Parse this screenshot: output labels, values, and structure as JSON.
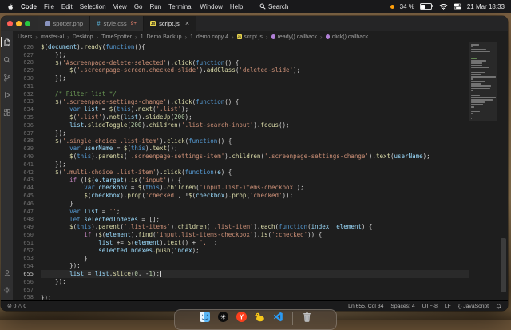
{
  "theme": {
    "p": "#d4d4d4",
    "f": "#dcdcaa",
    "k": "#569cd6",
    "c": "#c586c0",
    "s": "#ce9178",
    "n": "#b5cea8",
    "m": "#6a9955",
    "v": "#9cdcfe"
  },
  "menubar": {
    "menus": [
      "Code",
      "File",
      "Edit",
      "Selection",
      "View",
      "Go",
      "Run",
      "Terminal",
      "Window",
      "Help"
    ],
    "spotlight_label": "Search",
    "battery_percent": "34 %",
    "clock": "21 Mar 18:33"
  },
  "window": {
    "tabs": [
      {
        "label": "spotter.php",
        "icon": "php",
        "active": false
      },
      {
        "label": "style.css",
        "icon": "css",
        "badge": "9+",
        "active": false
      },
      {
        "label": "script.js",
        "icon": "js",
        "active": true
      }
    ],
    "breadcrumbs": [
      {
        "label": "Users"
      },
      {
        "label": "master-al"
      },
      {
        "label": "Desktop"
      },
      {
        "label": "TimeSpotter"
      },
      {
        "label": "1. Demo Backup"
      },
      {
        "label": "1. demo copy 4"
      },
      {
        "label": "script.js",
        "icon": "js"
      },
      {
        "label": "ready() callback",
        "icon": "symbol"
      },
      {
        "label": "click() callback",
        "icon": "symbol"
      }
    ]
  },
  "activity_bar": {
    "top": [
      "explorer",
      "search",
      "source-control",
      "run-debug",
      "extensions"
    ],
    "bottom": [
      "account",
      "settings"
    ],
    "active": "explorer"
  },
  "editor": {
    "cursor_line": 655,
    "lines": [
      {
        "n": 626,
        "t": [
          [
            "f",
            "$"
          ],
          [
            "p",
            "("
          ],
          [
            "v",
            "document"
          ],
          [
            "p",
            ")."
          ],
          [
            "f",
            "ready"
          ],
          [
            "p",
            "("
          ],
          [
            "k",
            "function"
          ],
          [
            "p",
            "(){"
          ]
        ]
      },
      {
        "n": 627,
        "t": [
          [
            "p",
            "    });"
          ]
        ]
      },
      {
        "n": 628,
        "t": [
          [
            "p",
            "    "
          ],
          [
            "f",
            "$"
          ],
          [
            "p",
            "("
          ],
          [
            "s",
            "'#screenpage-delete-selected'"
          ],
          [
            "p",
            ")."
          ],
          [
            "f",
            "click"
          ],
          [
            "p",
            "("
          ],
          [
            "k",
            "function"
          ],
          [
            "p",
            "() {"
          ]
        ]
      },
      {
        "n": 629,
        "t": [
          [
            "p",
            "        "
          ],
          [
            "f",
            "$"
          ],
          [
            "p",
            "("
          ],
          [
            "s",
            "'.screenpage-screen.checked-slide'"
          ],
          [
            "p",
            ")."
          ],
          [
            "f",
            "addClass"
          ],
          [
            "p",
            "("
          ],
          [
            "s",
            "'deleted-slide'"
          ],
          [
            "p",
            ");"
          ]
        ]
      },
      {
        "n": 630,
        "t": [
          [
            "p",
            "    });"
          ]
        ]
      },
      {
        "n": 631,
        "t": []
      },
      {
        "n": 632,
        "t": [
          [
            "m",
            "    /* Filter list */"
          ]
        ]
      },
      {
        "n": 633,
        "t": [
          [
            "p",
            "    "
          ],
          [
            "f",
            "$"
          ],
          [
            "p",
            "("
          ],
          [
            "s",
            "'.screenpage-settings-change'"
          ],
          [
            "p",
            ")."
          ],
          [
            "f",
            "click"
          ],
          [
            "p",
            "("
          ],
          [
            "k",
            "function"
          ],
          [
            "p",
            "() {"
          ]
        ]
      },
      {
        "n": 634,
        "t": [
          [
            "p",
            "        "
          ],
          [
            "k",
            "var "
          ],
          [
            "v",
            "list"
          ],
          [
            "p",
            " = "
          ],
          [
            "f",
            "$"
          ],
          [
            "p",
            "("
          ],
          [
            "k",
            "this"
          ],
          [
            "p",
            ")."
          ],
          [
            "f",
            "next"
          ],
          [
            "p",
            "("
          ],
          [
            "s",
            "'.list'"
          ],
          [
            "p",
            ");"
          ]
        ]
      },
      {
        "n": 635,
        "t": [
          [
            "p",
            "        "
          ],
          [
            "f",
            "$"
          ],
          [
            "p",
            "("
          ],
          [
            "s",
            "'.list'"
          ],
          [
            "p",
            ")."
          ],
          [
            "f",
            "not"
          ],
          [
            "p",
            "("
          ],
          [
            "v",
            "list"
          ],
          [
            "p",
            ")."
          ],
          [
            "f",
            "slideUp"
          ],
          [
            "p",
            "("
          ],
          [
            "n",
            "200"
          ],
          [
            "p",
            ");"
          ]
        ]
      },
      {
        "n": 636,
        "t": [
          [
            "p",
            "        "
          ],
          [
            "v",
            "list"
          ],
          [
            "p",
            "."
          ],
          [
            "f",
            "slideToggle"
          ],
          [
            "p",
            "("
          ],
          [
            "n",
            "200"
          ],
          [
            "p",
            ")."
          ],
          [
            "f",
            "children"
          ],
          [
            "p",
            "("
          ],
          [
            "s",
            "'.list-search-input'"
          ],
          [
            "p",
            ")."
          ],
          [
            "f",
            "focus"
          ],
          [
            "p",
            "();"
          ]
        ]
      },
      {
        "n": 637,
        "t": [
          [
            "p",
            "    });"
          ]
        ]
      },
      {
        "n": 638,
        "t": [
          [
            "p",
            "    "
          ],
          [
            "f",
            "$"
          ],
          [
            "p",
            "("
          ],
          [
            "s",
            "'.single-choice .list-item'"
          ],
          [
            "p",
            ")."
          ],
          [
            "f",
            "click"
          ],
          [
            "p",
            "("
          ],
          [
            "k",
            "function"
          ],
          [
            "p",
            "() {"
          ]
        ]
      },
      {
        "n": 639,
        "t": [
          [
            "p",
            "        "
          ],
          [
            "k",
            "var "
          ],
          [
            "v",
            "userName"
          ],
          [
            "p",
            " = "
          ],
          [
            "f",
            "$"
          ],
          [
            "p",
            "("
          ],
          [
            "k",
            "this"
          ],
          [
            "p",
            ")."
          ],
          [
            "f",
            "text"
          ],
          [
            "p",
            "();"
          ]
        ]
      },
      {
        "n": 640,
        "t": [
          [
            "p",
            "        "
          ],
          [
            "f",
            "$"
          ],
          [
            "p",
            "("
          ],
          [
            "k",
            "this"
          ],
          [
            "p",
            ")."
          ],
          [
            "f",
            "parents"
          ],
          [
            "p",
            "("
          ],
          [
            "s",
            "'.screenpage-settings-item'"
          ],
          [
            "p",
            ")."
          ],
          [
            "f",
            "children"
          ],
          [
            "p",
            "("
          ],
          [
            "s",
            "'.screenpage-settings-change'"
          ],
          [
            "p",
            ")."
          ],
          [
            "f",
            "text"
          ],
          [
            "p",
            "("
          ],
          [
            "v",
            "userName"
          ],
          [
            "p",
            ");"
          ]
        ]
      },
      {
        "n": 641,
        "t": [
          [
            "p",
            "    });"
          ]
        ]
      },
      {
        "n": 642,
        "t": [
          [
            "p",
            "    "
          ],
          [
            "f",
            "$"
          ],
          [
            "p",
            "("
          ],
          [
            "s",
            "'.multi-choice .list-item'"
          ],
          [
            "p",
            ")."
          ],
          [
            "f",
            "click"
          ],
          [
            "p",
            "("
          ],
          [
            "k",
            "function"
          ],
          [
            "p",
            "("
          ],
          [
            "v",
            "e"
          ],
          [
            "p",
            ") {"
          ]
        ]
      },
      {
        "n": 643,
        "t": [
          [
            "p",
            "        "
          ],
          [
            "c",
            "if"
          ],
          [
            "p",
            " (!"
          ],
          [
            "f",
            "$"
          ],
          [
            "p",
            "("
          ],
          [
            "v",
            "e"
          ],
          [
            "p",
            "."
          ],
          [
            "v",
            "target"
          ],
          [
            "p",
            ")."
          ],
          [
            "f",
            "is"
          ],
          [
            "p",
            "("
          ],
          [
            "s",
            "'input'"
          ],
          [
            "p",
            ")) {"
          ]
        ]
      },
      {
        "n": 644,
        "t": [
          [
            "p",
            "            "
          ],
          [
            "k",
            "var "
          ],
          [
            "v",
            "checkbox"
          ],
          [
            "p",
            " = "
          ],
          [
            "f",
            "$"
          ],
          [
            "p",
            "("
          ],
          [
            "k",
            "this"
          ],
          [
            "p",
            ")."
          ],
          [
            "f",
            "children"
          ],
          [
            "p",
            "("
          ],
          [
            "s",
            "'input.list-items-checkbox'"
          ],
          [
            "p",
            ");"
          ]
        ]
      },
      {
        "n": 645,
        "t": [
          [
            "p",
            "            "
          ],
          [
            "f",
            "$"
          ],
          [
            "p",
            "("
          ],
          [
            "v",
            "checkbox"
          ],
          [
            "p",
            ")."
          ],
          [
            "f",
            "prop"
          ],
          [
            "p",
            "("
          ],
          [
            "s",
            "'checked'"
          ],
          [
            "p",
            ", !"
          ],
          [
            "f",
            "$"
          ],
          [
            "p",
            "("
          ],
          [
            "v",
            "checkbox"
          ],
          [
            "p",
            ")."
          ],
          [
            "f",
            "prop"
          ],
          [
            "p",
            "("
          ],
          [
            "s",
            "'checked'"
          ],
          [
            "p",
            "));"
          ]
        ]
      },
      {
        "n": 646,
        "t": [
          [
            "p",
            "        }"
          ]
        ]
      },
      {
        "n": 647,
        "t": [
          [
            "p",
            "        "
          ],
          [
            "k",
            "var "
          ],
          [
            "v",
            "list"
          ],
          [
            "p",
            " = "
          ],
          [
            "s",
            "''"
          ],
          [
            "p",
            ";"
          ]
        ]
      },
      {
        "n": 648,
        "t": [
          [
            "p",
            "        "
          ],
          [
            "k",
            "let "
          ],
          [
            "v",
            "selectedIndexes"
          ],
          [
            "p",
            " = [];"
          ]
        ]
      },
      {
        "n": 649,
        "t": [
          [
            "p",
            "        "
          ],
          [
            "f",
            "$"
          ],
          [
            "p",
            "("
          ],
          [
            "k",
            "this"
          ],
          [
            "p",
            ")."
          ],
          [
            "f",
            "parent"
          ],
          [
            "p",
            "("
          ],
          [
            "s",
            "'.list-items'"
          ],
          [
            "p",
            ")."
          ],
          [
            "f",
            "children"
          ],
          [
            "p",
            "("
          ],
          [
            "s",
            "'.list-item'"
          ],
          [
            "p",
            ")."
          ],
          [
            "f",
            "each"
          ],
          [
            "p",
            "("
          ],
          [
            "k",
            "function"
          ],
          [
            "p",
            "("
          ],
          [
            "v",
            "index"
          ],
          [
            "p",
            ", "
          ],
          [
            "v",
            "element"
          ],
          [
            "p",
            ") {"
          ]
        ]
      },
      {
        "n": 650,
        "t": [
          [
            "p",
            "            "
          ],
          [
            "c",
            "if"
          ],
          [
            "p",
            " ("
          ],
          [
            "f",
            "$"
          ],
          [
            "p",
            "("
          ],
          [
            "v",
            "element"
          ],
          [
            "p",
            ")."
          ],
          [
            "f",
            "find"
          ],
          [
            "p",
            "("
          ],
          [
            "s",
            "'input.list-items-checkbox'"
          ],
          [
            "p",
            ")."
          ],
          [
            "f",
            "is"
          ],
          [
            "p",
            "("
          ],
          [
            "s",
            "':checked'"
          ],
          [
            "p",
            ")) {"
          ]
        ]
      },
      {
        "n": 651,
        "t": [
          [
            "p",
            "                "
          ],
          [
            "v",
            "list"
          ],
          [
            "p",
            " += "
          ],
          [
            "f",
            "$"
          ],
          [
            "p",
            "("
          ],
          [
            "v",
            "element"
          ],
          [
            "p",
            ")."
          ],
          [
            "f",
            "text"
          ],
          [
            "p",
            "() + "
          ],
          [
            "s",
            "', '"
          ],
          [
            "p",
            ";"
          ]
        ]
      },
      {
        "n": 652,
        "t": [
          [
            "p",
            "                "
          ],
          [
            "v",
            "selectedIndexes"
          ],
          [
            "p",
            "."
          ],
          [
            "f",
            "push"
          ],
          [
            "p",
            "("
          ],
          [
            "v",
            "index"
          ],
          [
            "p",
            ");"
          ]
        ]
      },
      {
        "n": 653,
        "t": [
          [
            "p",
            "            }"
          ]
        ]
      },
      {
        "n": 654,
        "t": [
          [
            "p",
            "        });"
          ]
        ]
      },
      {
        "n": 655,
        "t": [
          [
            "p",
            "        "
          ],
          [
            "v",
            "list"
          ],
          [
            "p",
            " = "
          ],
          [
            "v",
            "list"
          ],
          [
            "p",
            "."
          ],
          [
            "f",
            "slice"
          ],
          [
            "p",
            "("
          ],
          [
            "n",
            "0"
          ],
          [
            "p",
            ", -"
          ],
          [
            "n",
            "1"
          ],
          [
            "p",
            ");"
          ]
        ]
      },
      {
        "n": 656,
        "t": [
          [
            "p",
            "    });"
          ]
        ]
      },
      {
        "n": 657,
        "t": []
      },
      {
        "n": 658,
        "t": [
          [
            "p",
            "});"
          ]
        ]
      }
    ]
  },
  "statusbar": {
    "left": [
      {
        "name": "problems",
        "text": "⊘ 0  △ 0"
      }
    ],
    "right": [
      {
        "name": "cursor-position",
        "text": "Ln 655, Col 34"
      },
      {
        "name": "indentation",
        "text": "Spaces: 4"
      },
      {
        "name": "encoding",
        "text": "UTF-8"
      },
      {
        "name": "eol",
        "text": "LF"
      },
      {
        "name": "language",
        "text": "{} JavaScript"
      }
    ]
  },
  "dock": {
    "items": [
      "finder",
      "chatgpt",
      "yandex",
      "cyberduck",
      "vscode",
      "separator",
      "trash"
    ]
  }
}
